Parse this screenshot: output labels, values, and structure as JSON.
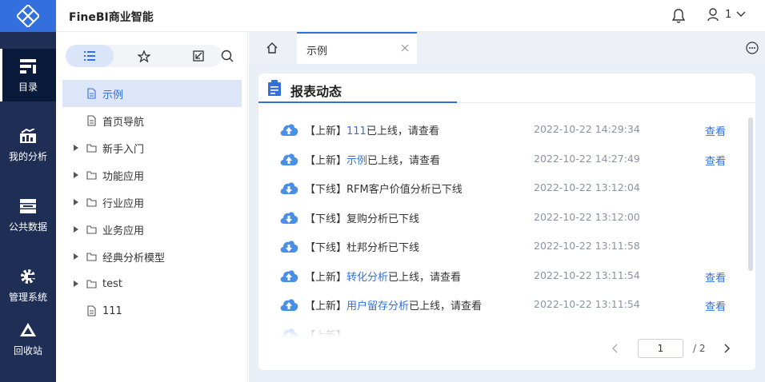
{
  "app": {
    "title": "FineBI商业智能"
  },
  "topbar": {
    "user_name": "1"
  },
  "nav": {
    "items": [
      {
        "label": "目录",
        "icon": "directory-icon"
      },
      {
        "label": "我的分析",
        "icon": "chart-icon"
      },
      {
        "label": "公共数据",
        "icon": "database-icon"
      },
      {
        "label": "管理系统",
        "icon": "settings-gear-icon"
      },
      {
        "label": "回收站",
        "icon": "recycle-icon"
      }
    ]
  },
  "dir": {
    "tree": [
      {
        "label": "示例",
        "type": "file"
      },
      {
        "label": "首页导航",
        "type": "file"
      },
      {
        "label": "新手入门",
        "type": "folder"
      },
      {
        "label": "功能应用",
        "type": "folder"
      },
      {
        "label": "行业应用",
        "type": "folder"
      },
      {
        "label": "业务应用",
        "type": "folder"
      },
      {
        "label": "经典分析模型",
        "type": "folder"
      },
      {
        "label": "test",
        "type": "folder"
      },
      {
        "label": "111",
        "type": "file"
      }
    ]
  },
  "tabs": {
    "active_label": "示例"
  },
  "report": {
    "title": "报表动态",
    "rows": [
      {
        "tag": "【上新】",
        "name": "111",
        "suffix": "已上线，请查看",
        "time": "2022-10-22 14:29:34",
        "action": "查看",
        "kind": "up"
      },
      {
        "tag": "【上新】",
        "name": "示例",
        "suffix": "已上线，请查看",
        "time": "2022-10-22 14:27:49",
        "action": "查看",
        "kind": "up"
      },
      {
        "tag": "【下线】",
        "name": "RFM客户价值分析已下线",
        "suffix": "",
        "time": "2022-10-22 13:12:04",
        "action": "",
        "kind": "down"
      },
      {
        "tag": "【下线】",
        "name": "复购分析已下线",
        "suffix": "",
        "time": "2022-10-22 13:12:00",
        "action": "",
        "kind": "down"
      },
      {
        "tag": "【下线】",
        "name": "杜邦分析已下线",
        "suffix": "",
        "time": "2022-10-22 13:11:58",
        "action": "",
        "kind": "down"
      },
      {
        "tag": "【上新】",
        "name": "转化分析",
        "suffix": "已上线，请查看",
        "time": "2022-10-22 13:11:54",
        "action": "查看",
        "kind": "up"
      },
      {
        "tag": "【上新】",
        "name": "用户留存分析",
        "suffix": "已上线，请查看",
        "time": "2022-10-22 13:11:54",
        "action": "查看",
        "kind": "up"
      },
      {
        "tag": "【上新】",
        "name": "",
        "suffix": "",
        "time": "",
        "action": "",
        "kind": "up"
      }
    ],
    "pager": {
      "page": "1",
      "total": "/ 2"
    }
  },
  "colors": {
    "brand": "#3370dd",
    "nav_bg": "#1e2e55",
    "up_icon": "#4a8fe7",
    "down_icon": "#4a8fe7"
  }
}
